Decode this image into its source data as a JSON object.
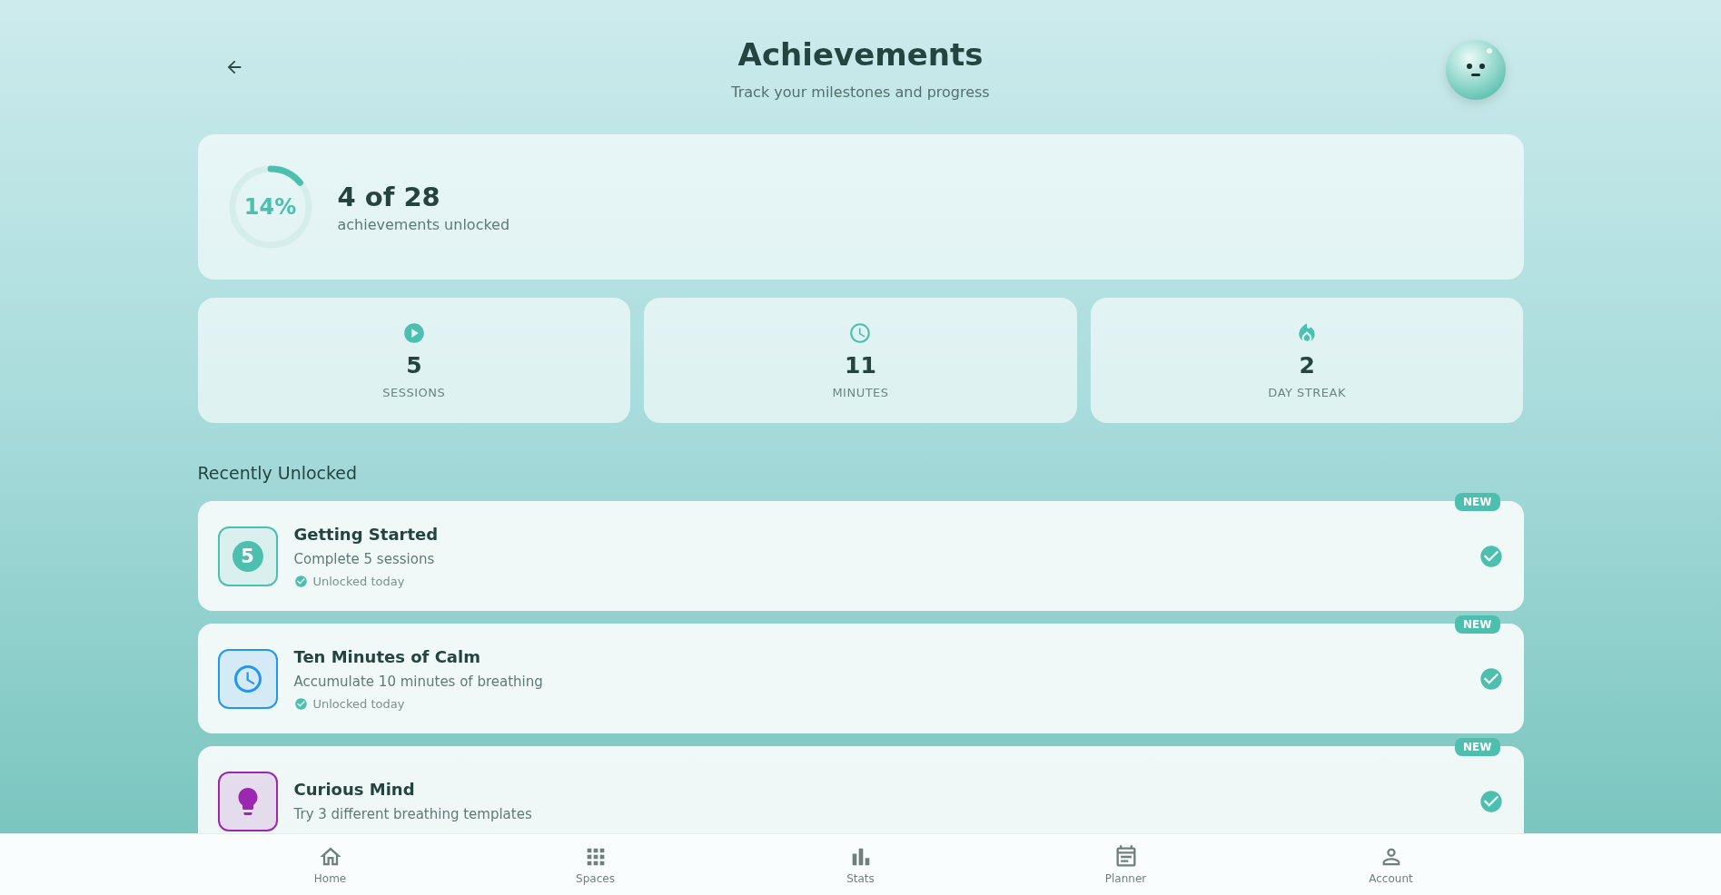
{
  "header": {
    "title": "Achievements",
    "subtitle": "Track your milestones and progress"
  },
  "summary": {
    "percent": "14%",
    "level": 0.14,
    "count": "4 of 28",
    "caption": "achievements unlocked"
  },
  "stats": [
    {
      "kind": "sessions",
      "value": "5",
      "label": "SESSIONS"
    },
    {
      "kind": "minutes",
      "value": "11",
      "label": "MINUTES"
    },
    {
      "kind": "streak",
      "value": "2",
      "label": "DAY STREAK"
    }
  ],
  "section_title": "Recently Unlocked",
  "achievements": [
    {
      "kind": "number",
      "glyph": "5",
      "color": "#4dbfae",
      "title": "Getting Started",
      "description": "Complete 5 sessions",
      "status": "Unlocked today",
      "badge": "NEW",
      "completed": true
    },
    {
      "kind": "clock",
      "color": "#2196f3",
      "title": "Ten Minutes of Calm",
      "description": "Accumulate 10 minutes of breathing",
      "status": "Unlocked today",
      "badge": "NEW",
      "completed": true
    },
    {
      "kind": "bulb",
      "color": "#9c27b0",
      "title": "Curious Mind",
      "description": "Try 3 different breathing templates",
      "badge": "NEW",
      "completed": true
    }
  ],
  "nav": [
    {
      "kind": "home",
      "label": "Home"
    },
    {
      "kind": "spaces",
      "label": "Spaces"
    },
    {
      "kind": "stats",
      "label": "Stats"
    },
    {
      "kind": "planner",
      "label": "Planner"
    },
    {
      "kind": "account",
      "label": "Account"
    }
  ]
}
